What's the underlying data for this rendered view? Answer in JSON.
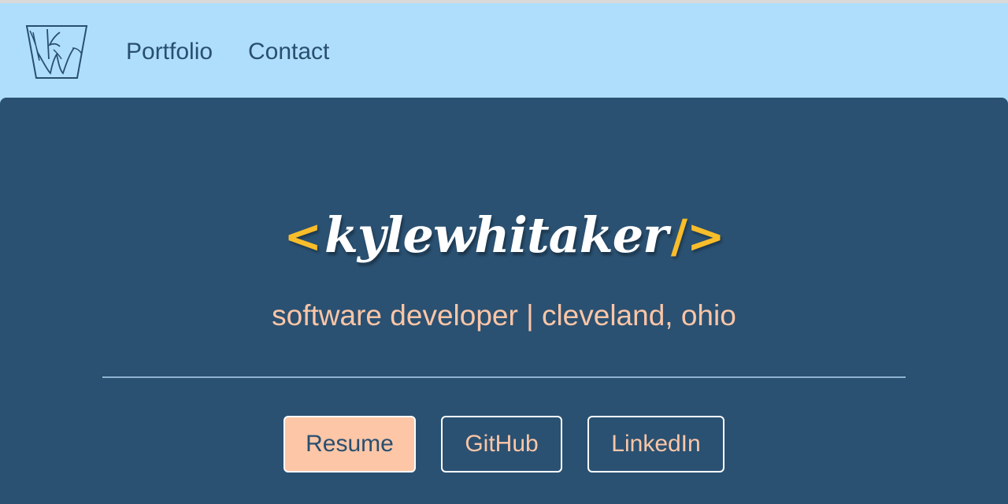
{
  "nav": {
    "logo_icon": "kw-monogram-logo-icon",
    "links": [
      "Portfolio",
      "Contact"
    ]
  },
  "hero": {
    "bracket_open": "<",
    "name": "kylewhitaker",
    "bracket_close": "/>",
    "subtitle": "software developer | cleveland, ohio",
    "buttons": [
      "Resume",
      "GitHub",
      "LinkedIn"
    ]
  },
  "colors": {
    "navbar_bg": "#afdefc",
    "hero_bg": "#2a5172",
    "accent_yellow": "#f8bd2a",
    "accent_peach": "#fcc6a7",
    "nav_text": "#294f6f"
  }
}
